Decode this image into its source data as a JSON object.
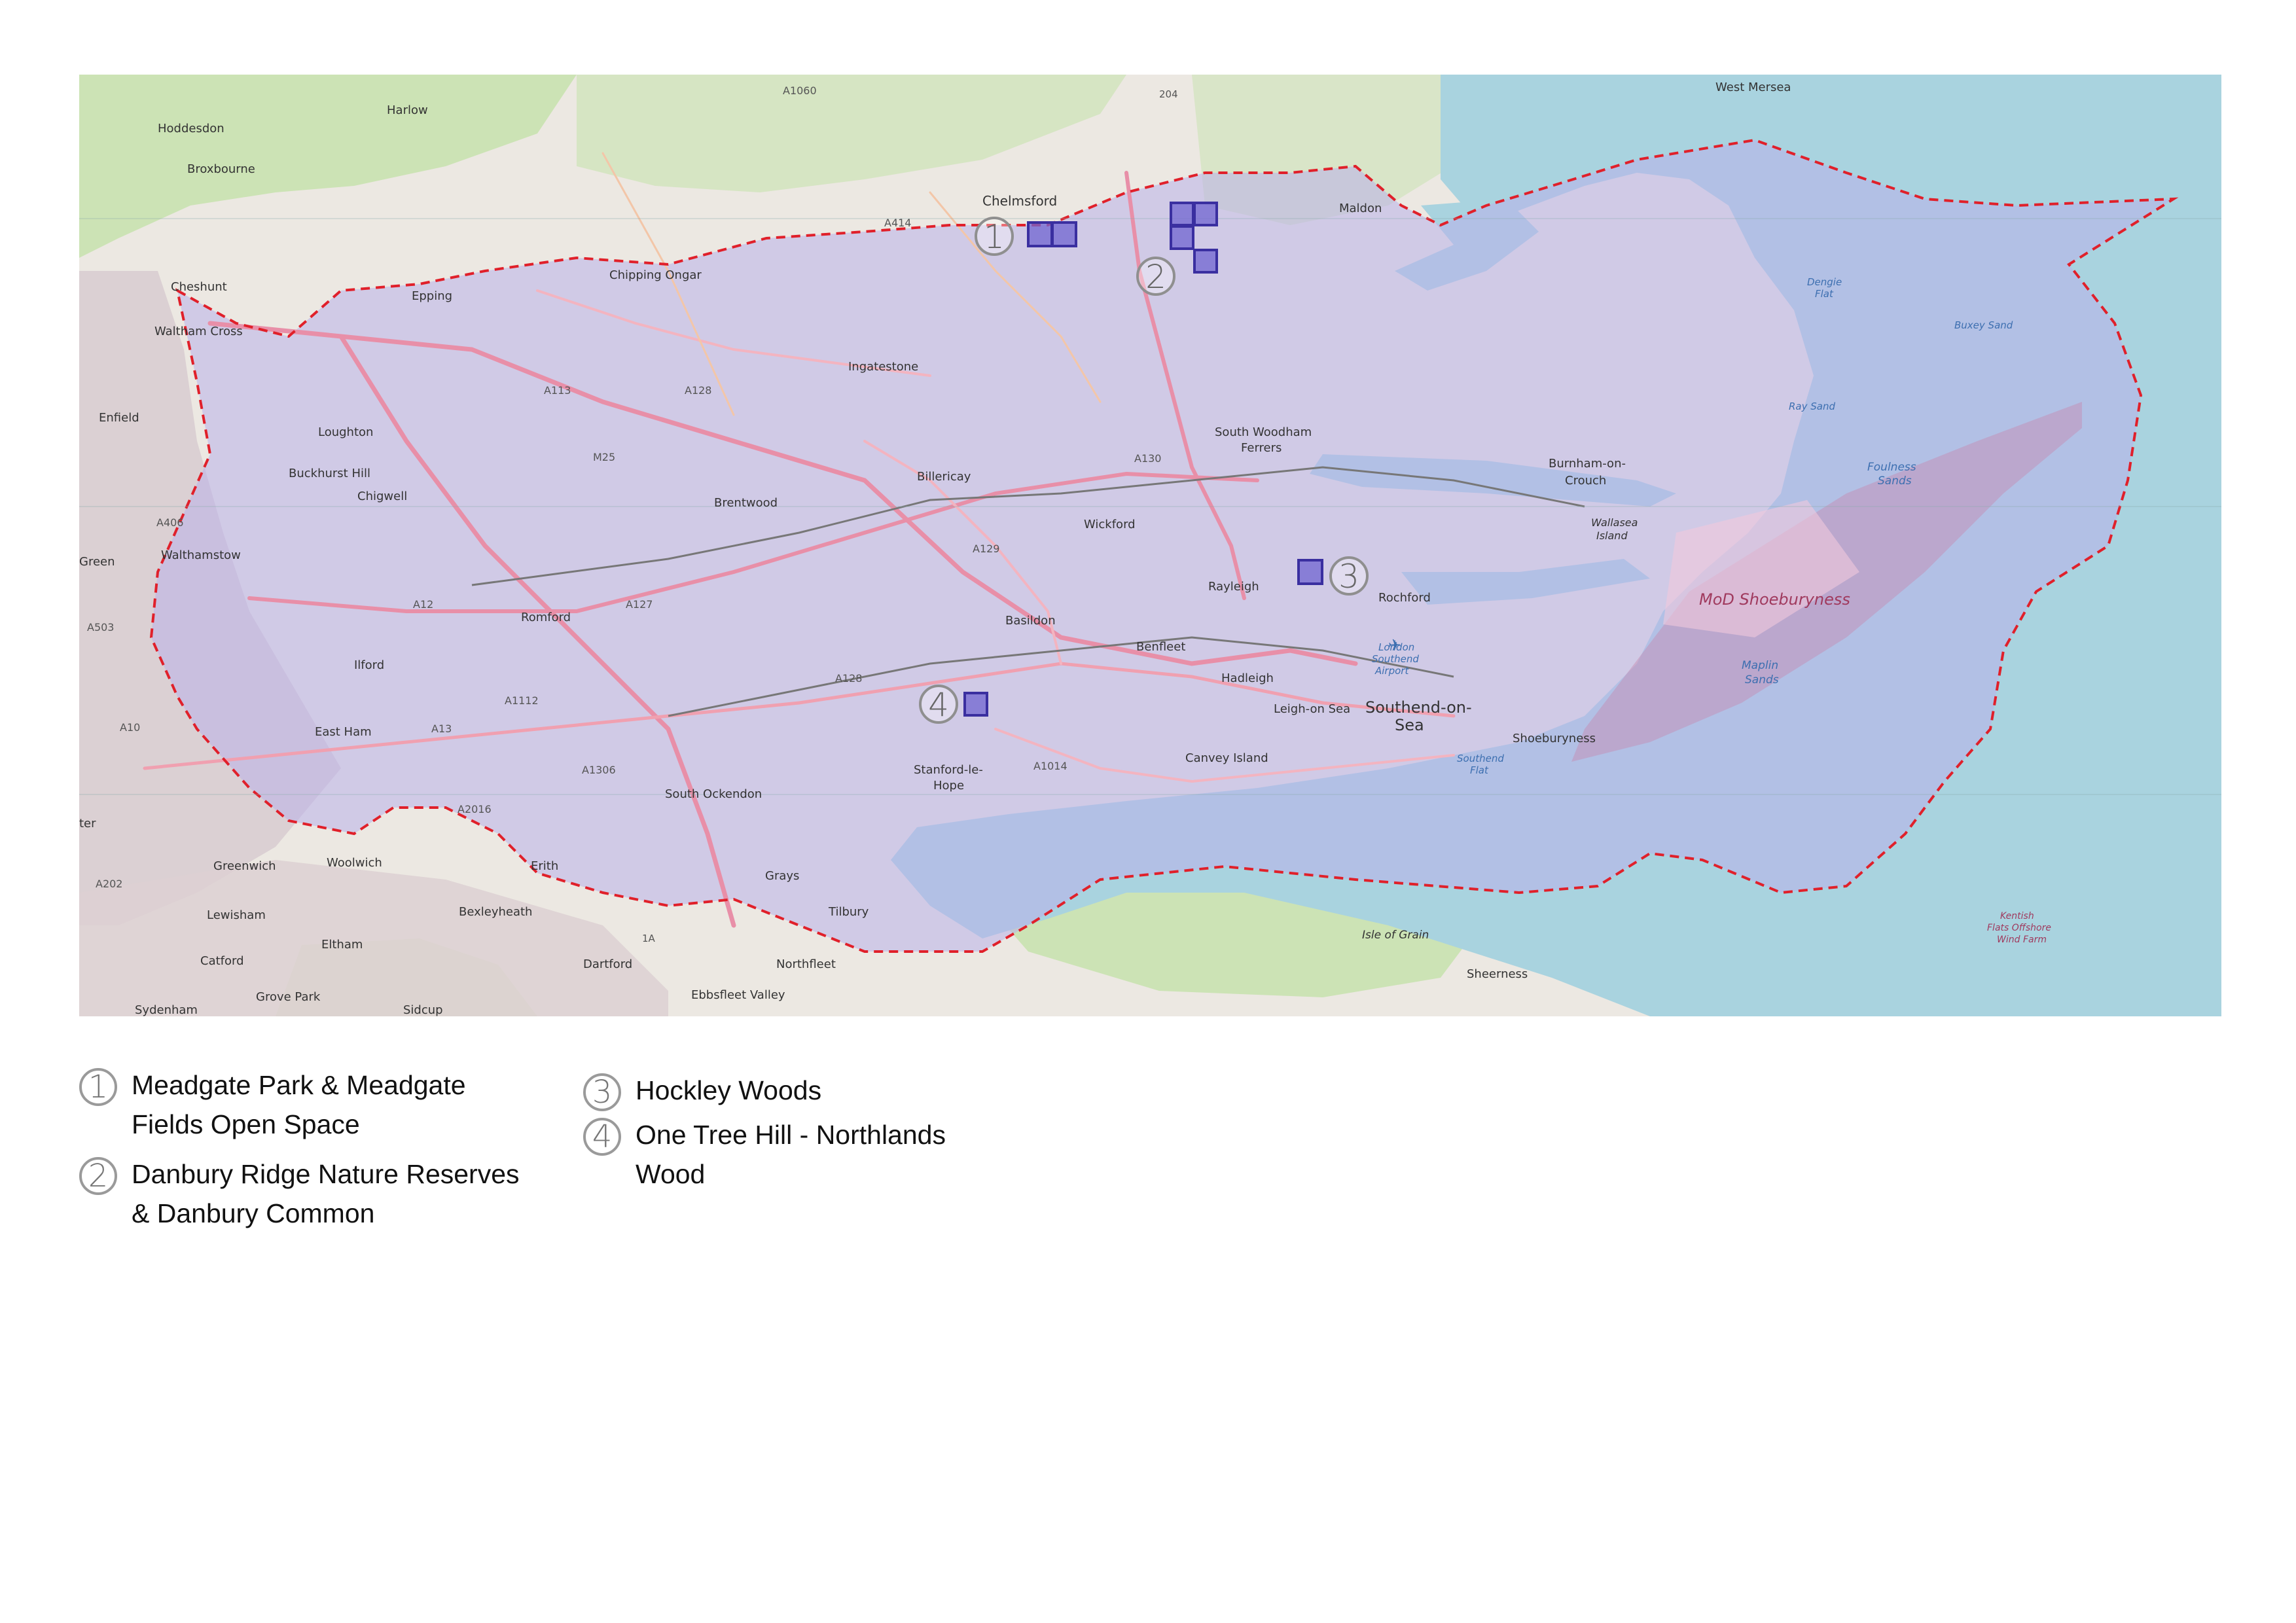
{
  "map": {
    "places": [
      {
        "id": "harlow",
        "name": "Harlow"
      },
      {
        "id": "hoddesdon",
        "name": "Hoddesdon"
      },
      {
        "id": "broxbourne",
        "name": "Broxbourne"
      },
      {
        "id": "cheshunt",
        "name": "Cheshunt"
      },
      {
        "id": "waltham-cross",
        "name": "Waltham Cross"
      },
      {
        "id": "enfield",
        "name": "Enfield"
      },
      {
        "id": "epping",
        "name": "Epping"
      },
      {
        "id": "loughton",
        "name": "Loughton"
      },
      {
        "id": "buckhurst-hill",
        "name": "Buckhurst Hill"
      },
      {
        "id": "chigwell",
        "name": "Chigwell"
      },
      {
        "id": "walthamstow",
        "name": "Walthamstow"
      },
      {
        "id": "green",
        "name": "Green"
      },
      {
        "id": "ilford",
        "name": "Ilford"
      },
      {
        "id": "romford",
        "name": "Romford"
      },
      {
        "id": "east-ham",
        "name": "East Ham"
      },
      {
        "id": "chipping-ongar",
        "name": "Chipping Ongar"
      },
      {
        "id": "chelmsford",
        "name": "Chelmsford"
      },
      {
        "id": "ingatestone",
        "name": "Ingatestone"
      },
      {
        "id": "brentwood",
        "name": "Brentwood"
      },
      {
        "id": "billericay",
        "name": "Billericay"
      },
      {
        "id": "wickford",
        "name": "Wickford"
      },
      {
        "id": "basildon",
        "name": "Basildon"
      },
      {
        "id": "rayleigh",
        "name": "Rayleigh"
      },
      {
        "id": "rochford",
        "name": "Rochford"
      },
      {
        "id": "benfleet",
        "name": "Benfleet"
      },
      {
        "id": "hadleigh",
        "name": "Hadleigh"
      },
      {
        "id": "leigh-on-sea",
        "name": "Leigh-on Sea"
      },
      {
        "id": "southend-1",
        "name": "Southend-on-"
      },
      {
        "id": "southend-2",
        "name": "Sea"
      },
      {
        "id": "shoeburyness",
        "name": "Shoeburyness"
      },
      {
        "id": "canvey-island",
        "name": "Canvey Island"
      },
      {
        "id": "stanford-1",
        "name": "Stanford-le-"
      },
      {
        "id": "stanford-2",
        "name": "Hope"
      },
      {
        "id": "south-ockendon",
        "name": "South Ockendon"
      },
      {
        "id": "grays",
        "name": "Grays"
      },
      {
        "id": "tilbury",
        "name": "Tilbury"
      },
      {
        "id": "erith",
        "name": "Erith"
      },
      {
        "id": "woolwich",
        "name": "Woolwich"
      },
      {
        "id": "greenwich",
        "name": "Greenwich"
      },
      {
        "id": "lewisham",
        "name": "Lewisham"
      },
      {
        "id": "bexleyheath",
        "name": "Bexleyheath"
      },
      {
        "id": "eltham",
        "name": "Eltham"
      },
      {
        "id": "catford",
        "name": "Catford"
      },
      {
        "id": "grove-park",
        "name": "Grove Park"
      },
      {
        "id": "sydenham",
        "name": "Sydenham"
      },
      {
        "id": "sidcup",
        "name": "Sidcup"
      },
      {
        "id": "dartford",
        "name": "Dartford"
      },
      {
        "id": "northfleet",
        "name": "Northfleet"
      },
      {
        "id": "ebbsfleet",
        "name": "Ebbsfleet Valley"
      },
      {
        "id": "isle-of-grain",
        "name": "Isle of Grain"
      },
      {
        "id": "sheerness",
        "name": "Sheerness"
      },
      {
        "id": "maldon",
        "name": "Maldon"
      },
      {
        "id": "west-mersea",
        "name": "West Mersea"
      },
      {
        "id": "swf-1",
        "name": "South Woodham"
      },
      {
        "id": "swf-2",
        "name": "Ferrers"
      },
      {
        "id": "burnham-1",
        "name": "Burnham-on-"
      },
      {
        "id": "burnham-2",
        "name": "Crouch"
      },
      {
        "id": "wallasea-1",
        "name": "Wallasea"
      },
      {
        "id": "wallasea-2",
        "name": "Island"
      },
      {
        "id": "ter",
        "name": "ter"
      },
      {
        "id": "lsa-1",
        "name": "London"
      },
      {
        "id": "lsa-2",
        "name": "Southend"
      },
      {
        "id": "lsa-3",
        "name": "Airport"
      }
    ],
    "roads": [
      {
        "id": "a1060",
        "name": "A1060"
      },
      {
        "id": "a414",
        "name": "A414"
      },
      {
        "id": "a113",
        "name": "A113"
      },
      {
        "id": "a128-n",
        "name": "A128"
      },
      {
        "id": "m25",
        "name": "M25"
      },
      {
        "id": "a130",
        "name": "A130"
      },
      {
        "id": "a129",
        "name": "A129"
      },
      {
        "id": "a406",
        "name": "A406"
      },
      {
        "id": "a12",
        "name": "A12"
      },
      {
        "id": "a127",
        "name": "A127"
      },
      {
        "id": "a503",
        "name": "A503"
      },
      {
        "id": "a1112",
        "name": "A1112"
      },
      {
        "id": "a10",
        "name": "A10"
      },
      {
        "id": "a13",
        "name": "A13"
      },
      {
        "id": "a1306",
        "name": "A1306"
      },
      {
        "id": "a2016",
        "name": "A2016"
      },
      {
        "id": "a202",
        "name": "A202"
      },
      {
        "id": "a128-s",
        "name": "A128"
      },
      {
        "id": "a1014",
        "name": "A1014"
      },
      {
        "id": "j204",
        "name": "204"
      },
      {
        "id": "j1a",
        "name": "1A"
      }
    ],
    "sea_labels": [
      {
        "id": "dengie-1",
        "name": "Dengie"
      },
      {
        "id": "dengie-2",
        "name": "Flat"
      },
      {
        "id": "buxey",
        "name": "Buxey Sand"
      },
      {
        "id": "ray-sand",
        "name": "Ray Sand"
      },
      {
        "id": "foulness-1",
        "name": "Foulness"
      },
      {
        "id": "foulness-2",
        "name": "Sands"
      },
      {
        "id": "maplin-1",
        "name": "Maplin"
      },
      {
        "id": "maplin-2",
        "name": "Sands"
      },
      {
        "id": "southend-flat-1",
        "name": "Southend"
      },
      {
        "id": "southend-flat-2",
        "name": "Flat"
      },
      {
        "id": "kentish-1",
        "name": "Kentish"
      },
      {
        "id": "kentish-2",
        "name": "Flats Offshore"
      },
      {
        "id": "kentish-3",
        "name": "Wind Farm"
      }
    ],
    "military_label": "MoD Shoeburyness",
    "site_markers": [
      {
        "id": "1",
        "number": "1"
      },
      {
        "id": "2",
        "number": "2"
      },
      {
        "id": "3",
        "number": "3"
      },
      {
        "id": "4",
        "number": "4"
      }
    ],
    "colors": {
      "land": "#ece8e2",
      "sea": "#a9d3df",
      "study_area": "#b9b1ea",
      "boundary": "#e0202a",
      "site": "#5a4fc0",
      "green": "#b6d89a"
    }
  },
  "legend": [
    {
      "number": "1",
      "lines": [
        "Meadgate Park & Meadgate",
        "Fields Open Space"
      ]
    },
    {
      "number": "2",
      "lines": [
        "Danbury Ridge Nature Reserves",
        "& Danbury  Common"
      ]
    },
    {
      "number": "3",
      "lines": [
        "Hockley Woods"
      ]
    },
    {
      "number": "4",
      "lines": [
        "One Tree Hill - Northlands",
        "Wood"
      ]
    }
  ]
}
